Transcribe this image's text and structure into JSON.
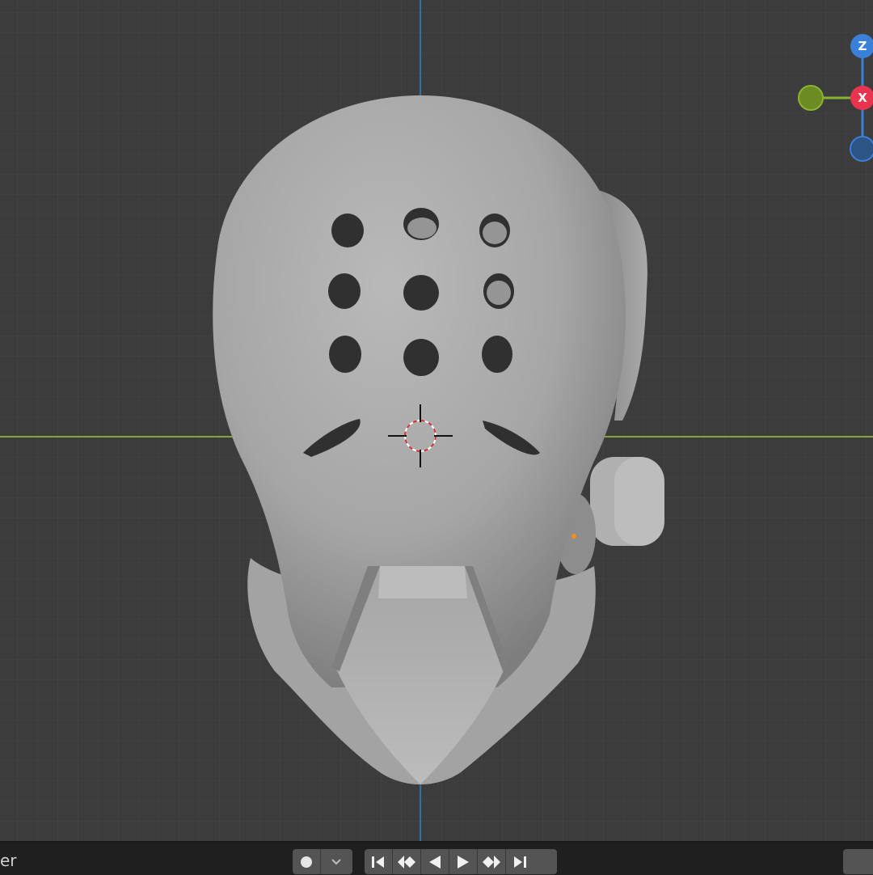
{
  "viewport": {
    "object": "helmet-model",
    "background_color": "#3c3c3c",
    "grid_line_color": "#4b4b4b",
    "x_axis_color": "#84a33a",
    "y_axis_color": "#2f6fa8"
  },
  "gizmo": {
    "z_label": "Z",
    "x_label": "X",
    "z_color": "#3a7fd8",
    "x_color": "#e8344f",
    "y_color": "#8ab42f"
  },
  "timeline": {
    "editor_label_partial": "er",
    "buttons": [
      "record-keyframe",
      "auto-key-dropdown",
      "jump-to-start",
      "previous-keyframe",
      "play-reverse",
      "play",
      "next-keyframe",
      "jump-to-end"
    ]
  }
}
